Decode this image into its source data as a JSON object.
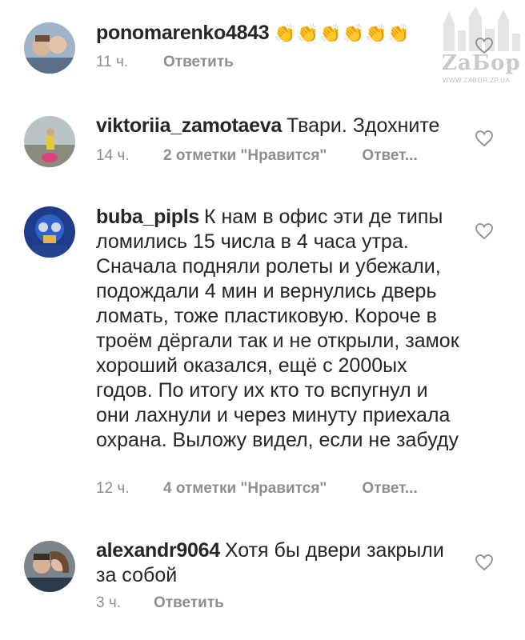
{
  "watermark": {
    "brand": "ZaБор",
    "url": "WWW.ZABOR.ZP.UA"
  },
  "comments": [
    {
      "username": "ponomarenko4843",
      "text": "👏👏👏👏👏👏",
      "time": "11 ч.",
      "likes": "",
      "reply": "Ответить"
    },
    {
      "username": "viktoriia_zamotaeva",
      "text": "Твари. Здохните",
      "time": "14 ч.",
      "likes": "2 отметки \"Нравится\"",
      "reply": "Ответ..."
    },
    {
      "username": "buba_pipls",
      "text": "К нам в офис эти де типы ломились 15 числа в 4 часа утра. Сначала подняли ролеты и убежали, подождали 4 мин и вернулись дверь ломать, тоже пластиковую. Короче в троём дёргали так и не открыли, замок хороший оказался, ещё с 2000ых годов. По итогу их кто то вспугнул и они лахнули и через минуту приехала охрана. Выложу видел, если не забуду",
      "time": "12 ч.",
      "likes": "4 отметки \"Нравится\"",
      "reply": "Ответ..."
    },
    {
      "username": "alexandr9064",
      "text": "Хотя бы двери закрыли за собой",
      "time": "3 ч.",
      "likes": "",
      "reply": "Ответить"
    }
  ]
}
